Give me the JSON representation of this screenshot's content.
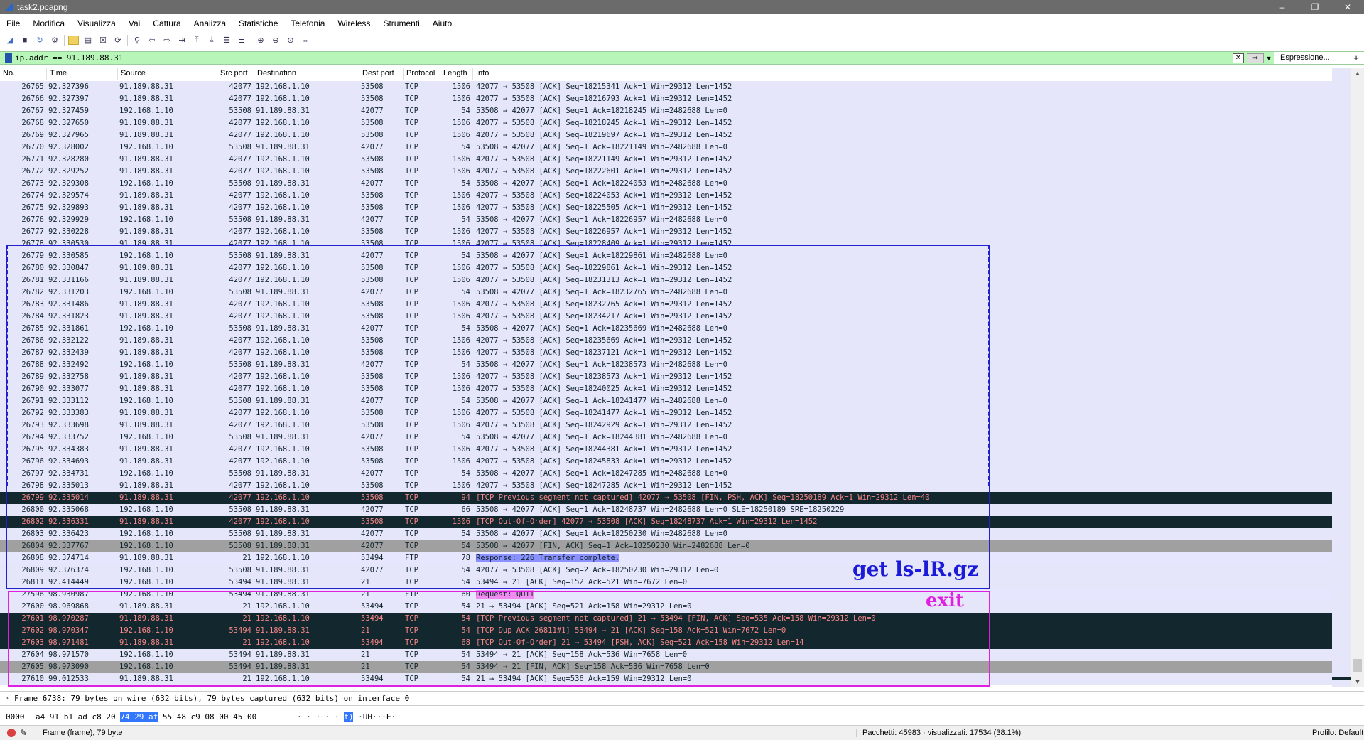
{
  "window": {
    "title": "task2.pcapng",
    "minimize": "–",
    "maximize": "❐",
    "close": "✕"
  },
  "menu": [
    "File",
    "Modifica",
    "Visualizza",
    "Vai",
    "Cattura",
    "Analizza",
    "Statistiche",
    "Telefonia",
    "Wireless",
    "Strumenti",
    "Aiuto"
  ],
  "filter": {
    "value": "ip.addr == 91.189.88.31",
    "expression_label": "Espressione...",
    "plus": "+"
  },
  "columns": [
    "No.",
    "Time",
    "Source",
    "Src port",
    "Destination",
    "Dest port",
    "Protocol",
    "Length",
    "Info"
  ],
  "packets": [
    {
      "no": "26765",
      "time": "92.327396",
      "src": "91.189.88.31",
      "sport": "42077",
      "dst": "192.168.1.10",
      "dport": "53508",
      "proto": "TCP",
      "len": "1506",
      "info": "42077 → 53508 [ACK] Seq=18215341 Ack=1 Win=29312 Len=1452",
      "style": ""
    },
    {
      "no": "26766",
      "time": "92.327397",
      "src": "91.189.88.31",
      "sport": "42077",
      "dst": "192.168.1.10",
      "dport": "53508",
      "proto": "TCP",
      "len": "1506",
      "info": "42077 → 53508 [ACK] Seq=18216793 Ack=1 Win=29312 Len=1452",
      "style": ""
    },
    {
      "no": "26767",
      "time": "92.327459",
      "src": "192.168.1.10",
      "sport": "53508",
      "dst": "91.189.88.31",
      "dport": "42077",
      "proto": "TCP",
      "len": "54",
      "info": "53508 → 42077 [ACK] Seq=1 Ack=18218245 Win=2482688 Len=0",
      "style": ""
    },
    {
      "no": "26768",
      "time": "92.327650",
      "src": "91.189.88.31",
      "sport": "42077",
      "dst": "192.168.1.10",
      "dport": "53508",
      "proto": "TCP",
      "len": "1506",
      "info": "42077 → 53508 [ACK] Seq=18218245 Ack=1 Win=29312 Len=1452",
      "style": ""
    },
    {
      "no": "26769",
      "time": "92.327965",
      "src": "91.189.88.31",
      "sport": "42077",
      "dst": "192.168.1.10",
      "dport": "53508",
      "proto": "TCP",
      "len": "1506",
      "info": "42077 → 53508 [ACK] Seq=18219697 Ack=1 Win=29312 Len=1452",
      "style": ""
    },
    {
      "no": "26770",
      "time": "92.328002",
      "src": "192.168.1.10",
      "sport": "53508",
      "dst": "91.189.88.31",
      "dport": "42077",
      "proto": "TCP",
      "len": "54",
      "info": "53508 → 42077 [ACK] Seq=1 Ack=18221149 Win=2482688 Len=0",
      "style": ""
    },
    {
      "no": "26771",
      "time": "92.328280",
      "src": "91.189.88.31",
      "sport": "42077",
      "dst": "192.168.1.10",
      "dport": "53508",
      "proto": "TCP",
      "len": "1506",
      "info": "42077 → 53508 [ACK] Seq=18221149 Ack=1 Win=29312 Len=1452",
      "style": ""
    },
    {
      "no": "26772",
      "time": "92.329252",
      "src": "91.189.88.31",
      "sport": "42077",
      "dst": "192.168.1.10",
      "dport": "53508",
      "proto": "TCP",
      "len": "1506",
      "info": "42077 → 53508 [ACK] Seq=18222601 Ack=1 Win=29312 Len=1452",
      "style": ""
    },
    {
      "no": "26773",
      "time": "92.329308",
      "src": "192.168.1.10",
      "sport": "53508",
      "dst": "91.189.88.31",
      "dport": "42077",
      "proto": "TCP",
      "len": "54",
      "info": "53508 → 42077 [ACK] Seq=1 Ack=18224053 Win=2482688 Len=0",
      "style": ""
    },
    {
      "no": "26774",
      "time": "92.329574",
      "src": "91.189.88.31",
      "sport": "42077",
      "dst": "192.168.1.10",
      "dport": "53508",
      "proto": "TCP",
      "len": "1506",
      "info": "42077 → 53508 [ACK] Seq=18224053 Ack=1 Win=29312 Len=1452",
      "style": ""
    },
    {
      "no": "26775",
      "time": "92.329893",
      "src": "91.189.88.31",
      "sport": "42077",
      "dst": "192.168.1.10",
      "dport": "53508",
      "proto": "TCP",
      "len": "1506",
      "info": "42077 → 53508 [ACK] Seq=18225505 Ack=1 Win=29312 Len=1452",
      "style": ""
    },
    {
      "no": "26776",
      "time": "92.329929",
      "src": "192.168.1.10",
      "sport": "53508",
      "dst": "91.189.88.31",
      "dport": "42077",
      "proto": "TCP",
      "len": "54",
      "info": "53508 → 42077 [ACK] Seq=1 Ack=18226957 Win=2482688 Len=0",
      "style": ""
    },
    {
      "no": "26777",
      "time": "92.330228",
      "src": "91.189.88.31",
      "sport": "42077",
      "dst": "192.168.1.10",
      "dport": "53508",
      "proto": "TCP",
      "len": "1506",
      "info": "42077 → 53508 [ACK] Seq=18226957 Ack=1 Win=29312 Len=1452",
      "style": ""
    },
    {
      "no": "26778",
      "time": "92.330530",
      "src": "91.189.88.31",
      "sport": "42077",
      "dst": "192.168.1.10",
      "dport": "53508",
      "proto": "TCP",
      "len": "1506",
      "info": "42077 → 53508 [ACK] Seq=18228409 Ack=1 Win=29312 Len=1452",
      "style": ""
    },
    {
      "no": "26779",
      "time": "92.330585",
      "src": "192.168.1.10",
      "sport": "53508",
      "dst": "91.189.88.31",
      "dport": "42077",
      "proto": "TCP",
      "len": "54",
      "info": "53508 → 42077 [ACK] Seq=1 Ack=18229861 Win=2482688 Len=0",
      "style": ""
    },
    {
      "no": "26780",
      "time": "92.330847",
      "src": "91.189.88.31",
      "sport": "42077",
      "dst": "192.168.1.10",
      "dport": "53508",
      "proto": "TCP",
      "len": "1506",
      "info": "42077 → 53508 [ACK] Seq=18229861 Ack=1 Win=29312 Len=1452",
      "style": ""
    },
    {
      "no": "26781",
      "time": "92.331166",
      "src": "91.189.88.31",
      "sport": "42077",
      "dst": "192.168.1.10",
      "dport": "53508",
      "proto": "TCP",
      "len": "1506",
      "info": "42077 → 53508 [ACK] Seq=18231313 Ack=1 Win=29312 Len=1452",
      "style": ""
    },
    {
      "no": "26782",
      "time": "92.331203",
      "src": "192.168.1.10",
      "sport": "53508",
      "dst": "91.189.88.31",
      "dport": "42077",
      "proto": "TCP",
      "len": "54",
      "info": "53508 → 42077 [ACK] Seq=1 Ack=18232765 Win=2482688 Len=0",
      "style": ""
    },
    {
      "no": "26783",
      "time": "92.331486",
      "src": "91.189.88.31",
      "sport": "42077",
      "dst": "192.168.1.10",
      "dport": "53508",
      "proto": "TCP",
      "len": "1506",
      "info": "42077 → 53508 [ACK] Seq=18232765 Ack=1 Win=29312 Len=1452",
      "style": ""
    },
    {
      "no": "26784",
      "time": "92.331823",
      "src": "91.189.88.31",
      "sport": "42077",
      "dst": "192.168.1.10",
      "dport": "53508",
      "proto": "TCP",
      "len": "1506",
      "info": "42077 → 53508 [ACK] Seq=18234217 Ack=1 Win=29312 Len=1452",
      "style": ""
    },
    {
      "no": "26785",
      "time": "92.331861",
      "src": "192.168.1.10",
      "sport": "53508",
      "dst": "91.189.88.31",
      "dport": "42077",
      "proto": "TCP",
      "len": "54",
      "info": "53508 → 42077 [ACK] Seq=1 Ack=18235669 Win=2482688 Len=0",
      "style": ""
    },
    {
      "no": "26786",
      "time": "92.332122",
      "src": "91.189.88.31",
      "sport": "42077",
      "dst": "192.168.1.10",
      "dport": "53508",
      "proto": "TCP",
      "len": "1506",
      "info": "42077 → 53508 [ACK] Seq=18235669 Ack=1 Win=29312 Len=1452",
      "style": ""
    },
    {
      "no": "26787",
      "time": "92.332439",
      "src": "91.189.88.31",
      "sport": "42077",
      "dst": "192.168.1.10",
      "dport": "53508",
      "proto": "TCP",
      "len": "1506",
      "info": "42077 → 53508 [ACK] Seq=18237121 Ack=1 Win=29312 Len=1452",
      "style": ""
    },
    {
      "no": "26788",
      "time": "92.332492",
      "src": "192.168.1.10",
      "sport": "53508",
      "dst": "91.189.88.31",
      "dport": "42077",
      "proto": "TCP",
      "len": "54",
      "info": "53508 → 42077 [ACK] Seq=1 Ack=18238573 Win=2482688 Len=0",
      "style": ""
    },
    {
      "no": "26789",
      "time": "92.332758",
      "src": "91.189.88.31",
      "sport": "42077",
      "dst": "192.168.1.10",
      "dport": "53508",
      "proto": "TCP",
      "len": "1506",
      "info": "42077 → 53508 [ACK] Seq=18238573 Ack=1 Win=29312 Len=1452",
      "style": ""
    },
    {
      "no": "26790",
      "time": "92.333077",
      "src": "91.189.88.31",
      "sport": "42077",
      "dst": "192.168.1.10",
      "dport": "53508",
      "proto": "TCP",
      "len": "1506",
      "info": "42077 → 53508 [ACK] Seq=18240025 Ack=1 Win=29312 Len=1452",
      "style": ""
    },
    {
      "no": "26791",
      "time": "92.333112",
      "src": "192.168.1.10",
      "sport": "53508",
      "dst": "91.189.88.31",
      "dport": "42077",
      "proto": "TCP",
      "len": "54",
      "info": "53508 → 42077 [ACK] Seq=1 Ack=18241477 Win=2482688 Len=0",
      "style": ""
    },
    {
      "no": "26792",
      "time": "92.333383",
      "src": "91.189.88.31",
      "sport": "42077",
      "dst": "192.168.1.10",
      "dport": "53508",
      "proto": "TCP",
      "len": "1506",
      "info": "42077 → 53508 [ACK] Seq=18241477 Ack=1 Win=29312 Len=1452",
      "style": ""
    },
    {
      "no": "26793",
      "time": "92.333698",
      "src": "91.189.88.31",
      "sport": "42077",
      "dst": "192.168.1.10",
      "dport": "53508",
      "proto": "TCP",
      "len": "1506",
      "info": "42077 → 53508 [ACK] Seq=18242929 Ack=1 Win=29312 Len=1452",
      "style": ""
    },
    {
      "no": "26794",
      "time": "92.333752",
      "src": "192.168.1.10",
      "sport": "53508",
      "dst": "91.189.88.31",
      "dport": "42077",
      "proto": "TCP",
      "len": "54",
      "info": "53508 → 42077 [ACK] Seq=1 Ack=18244381 Win=2482688 Len=0",
      "style": ""
    },
    {
      "no": "26795",
      "time": "92.334383",
      "src": "91.189.88.31",
      "sport": "42077",
      "dst": "192.168.1.10",
      "dport": "53508",
      "proto": "TCP",
      "len": "1506",
      "info": "42077 → 53508 [ACK] Seq=18244381 Ack=1 Win=29312 Len=1452",
      "style": ""
    },
    {
      "no": "26796",
      "time": "92.334693",
      "src": "91.189.88.31",
      "sport": "42077",
      "dst": "192.168.1.10",
      "dport": "53508",
      "proto": "TCP",
      "len": "1506",
      "info": "42077 → 53508 [ACK] Seq=18245833 Ack=1 Win=29312 Len=1452",
      "style": ""
    },
    {
      "no": "26797",
      "time": "92.334731",
      "src": "192.168.1.10",
      "sport": "53508",
      "dst": "91.189.88.31",
      "dport": "42077",
      "proto": "TCP",
      "len": "54",
      "info": "53508 → 42077 [ACK] Seq=1 Ack=18247285 Win=2482688 Len=0",
      "style": ""
    },
    {
      "no": "26798",
      "time": "92.335013",
      "src": "91.189.88.31",
      "sport": "42077",
      "dst": "192.168.1.10",
      "dport": "53508",
      "proto": "TCP",
      "len": "1506",
      "info": "42077 → 53508 [ACK] Seq=18247285 Ack=1 Win=29312 Len=1452",
      "style": ""
    },
    {
      "no": "26799",
      "time": "92.335014",
      "src": "91.189.88.31",
      "sport": "42077",
      "dst": "192.168.1.10",
      "dport": "53508",
      "proto": "TCP",
      "len": "94",
      "info": "[TCP Previous segment not captured] 42077 → 53508 [FIN, PSH, ACK] Seq=18250189 Ack=1 Win=29312 Len=40",
      "style": "dark"
    },
    {
      "no": "26800",
      "time": "92.335068",
      "src": "192.168.1.10",
      "sport": "53508",
      "dst": "91.189.88.31",
      "dport": "42077",
      "proto": "TCP",
      "len": "66",
      "info": "53508 → 42077 [ACK] Seq=1 Ack=18248737 Win=2482688 Len=0 SLE=18250189 SRE=18250229",
      "style": ""
    },
    {
      "no": "26802",
      "time": "92.336331",
      "src": "91.189.88.31",
      "sport": "42077",
      "dst": "192.168.1.10",
      "dport": "53508",
      "proto": "TCP",
      "len": "1506",
      "info": "[TCP Out-Of-Order] 42077 → 53508 [ACK] Seq=18248737 Ack=1 Win=29312 Len=1452",
      "style": "dark"
    },
    {
      "no": "26803",
      "time": "92.336423",
      "src": "192.168.1.10",
      "sport": "53508",
      "dst": "91.189.88.31",
      "dport": "42077",
      "proto": "TCP",
      "len": "54",
      "info": "53508 → 42077 [ACK] Seq=1 Ack=18250230 Win=2482688 Len=0",
      "style": ""
    },
    {
      "no": "26804",
      "time": "92.337767",
      "src": "192.168.1.10",
      "sport": "53508",
      "dst": "91.189.88.31",
      "dport": "42077",
      "proto": "TCP",
      "len": "54",
      "info": "53508 → 42077 [FIN, ACK] Seq=1 Ack=18250230 Win=2482688 Len=0",
      "style": "gray"
    },
    {
      "no": "26808",
      "time": "92.374714",
      "src": "91.189.88.31",
      "sport": "21",
      "dst": "192.168.1.10",
      "dport": "53494",
      "proto": "FTP",
      "len": "78",
      "info": "Response: 226 Transfer complete.",
      "style": "ftp",
      "hl": "blue"
    },
    {
      "no": "26809",
      "time": "92.376374",
      "src": "192.168.1.10",
      "sport": "53508",
      "dst": "91.189.88.31",
      "dport": "42077",
      "proto": "TCP",
      "len": "54",
      "info": "42077 → 53508 [ACK] Seq=2 Ack=18250230 Win=29312 Len=0",
      "style": ""
    },
    {
      "no": "26811",
      "time": "92.414449",
      "src": "192.168.1.10",
      "sport": "53494",
      "dst": "91.189.88.31",
      "dport": "21",
      "proto": "TCP",
      "len": "54",
      "info": "53494 → 21 [ACK] Seq=152 Ack=521 Win=7672 Len=0",
      "style": ""
    },
    {
      "no": "27596",
      "time": "98.930987",
      "src": "192.168.1.10",
      "sport": "53494",
      "dst": "91.189.88.31",
      "dport": "21",
      "proto": "FTP",
      "len": "60",
      "info": "Request: QUIT",
      "style": "ftp",
      "hl": "pink"
    },
    {
      "no": "27600",
      "time": "98.969868",
      "src": "91.189.88.31",
      "sport": "21",
      "dst": "192.168.1.10",
      "dport": "53494",
      "proto": "TCP",
      "len": "54",
      "info": "21 → 53494 [ACK] Seq=521 Ack=158 Win=29312 Len=0",
      "style": ""
    },
    {
      "no": "27601",
      "time": "98.970287",
      "src": "91.189.88.31",
      "sport": "21",
      "dst": "192.168.1.10",
      "dport": "53494",
      "proto": "TCP",
      "len": "54",
      "info": "[TCP Previous segment not captured] 21 → 53494 [FIN, ACK] Seq=535 Ack=158 Win=29312 Len=0",
      "style": "dark"
    },
    {
      "no": "27602",
      "time": "98.970347",
      "src": "192.168.1.10",
      "sport": "53494",
      "dst": "91.189.88.31",
      "dport": "21",
      "proto": "TCP",
      "len": "54",
      "info": "[TCP Dup ACK 26811#1] 53494 → 21 [ACK] Seq=158 Ack=521 Win=7672 Len=0",
      "style": "dark"
    },
    {
      "no": "27603",
      "time": "98.971481",
      "src": "91.189.88.31",
      "sport": "21",
      "dst": "192.168.1.10",
      "dport": "53494",
      "proto": "TCP",
      "len": "68",
      "info": "[TCP Out-Of-Order] 21 → 53494 [PSH, ACK] Seq=521 Ack=158 Win=29312 Len=14",
      "style": "dark"
    },
    {
      "no": "27604",
      "time": "98.971570",
      "src": "192.168.1.10",
      "sport": "53494",
      "dst": "91.189.88.31",
      "dport": "21",
      "proto": "TCP",
      "len": "54",
      "info": "53494 → 21 [ACK] Seq=158 Ack=536 Win=7658 Len=0",
      "style": ""
    },
    {
      "no": "27605",
      "time": "98.973090",
      "src": "192.168.1.10",
      "sport": "53494",
      "dst": "91.189.88.31",
      "dport": "21",
      "proto": "TCP",
      "len": "54",
      "info": "53494 → 21 [FIN, ACK] Seq=158 Ack=536 Win=7658 Len=0",
      "style": "gray"
    },
    {
      "no": "27610",
      "time": "99.012533",
      "src": "91.189.88.31",
      "sport": "21",
      "dst": "192.168.1.10",
      "dport": "53494",
      "proto": "TCP",
      "len": "54",
      "info": "21 → 53494 [ACK] Seq=536 Ack=159 Win=29312 Len=0",
      "style": ""
    }
  ],
  "annotations": {
    "blue_label": "get ls-lR.gz",
    "pink_label": "exit",
    "blue_color": "#1a1ad8",
    "pink_color": "#e020e0"
  },
  "detail": {
    "frame_summary": "Frame 6738: 79 bytes on wire (632 bits), 79 bytes captured (632 bits) on interface 0"
  },
  "hex": {
    "offset": "0000",
    "bytes_before": "a4 91 b1 ad c8 20 ",
    "bytes_selected": "74 29  af",
    "bytes_after": " 55 48 c9 08 00 45 00",
    "ascii_before": "· · · · · ",
    "ascii_selected": "t)",
    "ascii_after": " ·UH···E·"
  },
  "status": {
    "frame": "Frame (frame), 79 byte",
    "packets": "Pacchetti: 45983 · visualizzati: 17534 (38.1%)",
    "profile": "Profilo: Default"
  },
  "colors": {
    "row_default": "#e6e6fa",
    "row_dark": "#12272e",
    "row_dark_text": "#f78787",
    "row_gray": "#a0a0a0",
    "filter_valid": "#b8f5b8"
  }
}
